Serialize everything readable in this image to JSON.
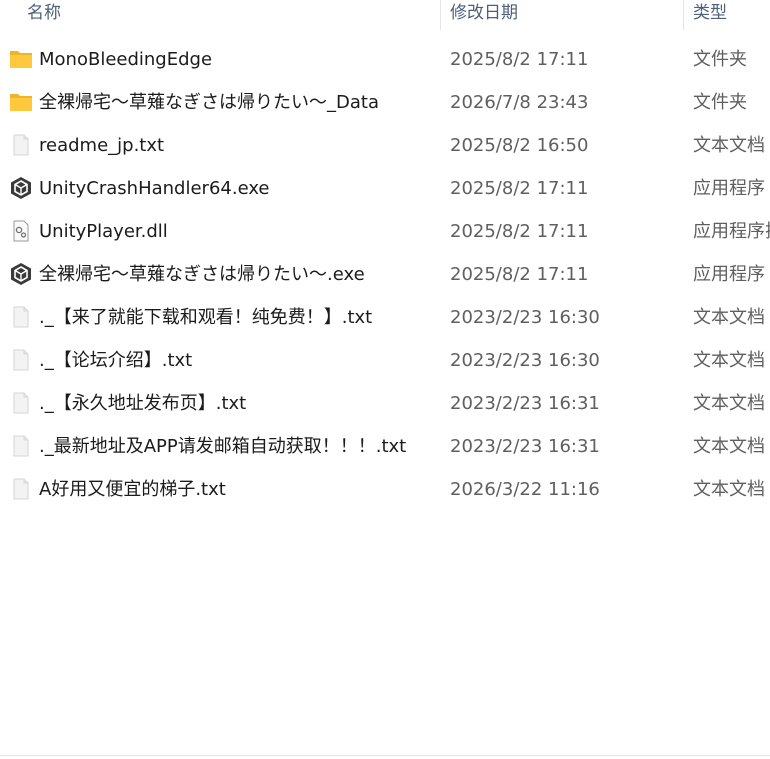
{
  "columns": {
    "name": "名称",
    "date": "修改日期",
    "type": "类型"
  },
  "files": [
    {
      "name": "MonoBleedingEdge",
      "date": "2025/8/2 17:11",
      "type": "文件夹",
      "icon": "folder-icon"
    },
    {
      "name": "全裸帰宅～草薙なぎさは帰りたい～_Data",
      "date": "2026/7/8 23:43",
      "type": "文件夹",
      "icon": "folder-icon"
    },
    {
      "name": "readme_jp.txt",
      "date": "2025/8/2 16:50",
      "type": "文本文档",
      "icon": "text-file-icon"
    },
    {
      "name": "UnityCrashHandler64.exe",
      "date": "2025/8/2 17:11",
      "type": "应用程序",
      "icon": "unity-exe-icon"
    },
    {
      "name": "UnityPlayer.dll",
      "date": "2025/8/2 17:11",
      "type": "应用程序扩",
      "icon": "dll-file-icon"
    },
    {
      "name": "全裸帰宅～草薙なぎさは帰りたい～.exe",
      "date": "2025/8/2 17:11",
      "type": "应用程序",
      "icon": "unity-exe-icon"
    },
    {
      "name": "._【来了就能下载和观看！纯免费！】.txt",
      "date": "2023/2/23 16:30",
      "type": "文本文档",
      "icon": "text-file-icon"
    },
    {
      "name": "._【论坛介绍】.txt",
      "date": "2023/2/23 16:30",
      "type": "文本文档",
      "icon": "text-file-icon"
    },
    {
      "name": "._【永久地址发布页】.txt",
      "date": "2023/2/23 16:31",
      "type": "文本文档",
      "icon": "text-file-icon"
    },
    {
      "name": "._最新地址及APP请发邮箱自动获取！！！.txt",
      "date": "2023/2/23 16:31",
      "type": "文本文档",
      "icon": "text-file-icon"
    },
    {
      "name": "A好用又便宜的梯子.txt",
      "date": "2026/3/22 11:16",
      "type": "文本文档",
      "icon": "text-file-icon"
    }
  ]
}
